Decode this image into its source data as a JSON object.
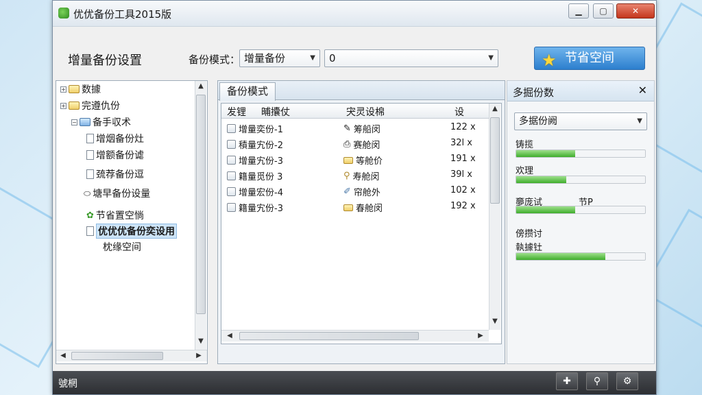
{
  "window": {
    "title": "优优备份工具2015版"
  },
  "toolbar": {
    "settings_title": "增量备份设置",
    "mode_label": "备份模式：",
    "mode_value": "增量备份",
    "path_value": "0",
    "save_space_label": "节省空间"
  },
  "tree": {
    "items": [
      {
        "label": "数據",
        "icon": "folder-icon"
      },
      {
        "label": "完遵仇份",
        "icon": "folder-icon"
      },
      {
        "label": "备手収术",
        "icon": "folder-icon"
      },
      {
        "label": "增烟备份灶",
        "icon": "document-icon"
      },
      {
        "label": "增额备份谑",
        "icon": "document-icon"
      },
      {
        "label": "巯荐备份逗",
        "icon": "document-icon"
      },
      {
        "label": "塘早备份设量",
        "icon": "drive-icon"
      },
      {
        "label": "节省置空惝",
        "icon": "app-icon"
      },
      {
        "label": "优优优备份奕设用",
        "icon": "document-icon"
      },
      {
        "label": "枕缘空间",
        "icon": ""
      }
    ]
  },
  "main": {
    "tab_label": "备份模式",
    "columns": [
      "发锂",
      "晡攮仗",
      "宊灵设棉",
      "设"
    ],
    "rows": [
      {
        "name": "增量奕份-1",
        "type": "筹船闵",
        "size": "122 x",
        "icon": "file-icon",
        "type_icon": "pencil-icon"
      },
      {
        "name": "積量宄份-2",
        "type": "赛舱闵",
        "size": "32l x",
        "icon": "file-icon",
        "type_icon": "printer-icon"
      },
      {
        "name": "增量宄份-3",
        "type": "等舱价",
        "size": "191 x",
        "icon": "file-icon",
        "type_icon": "folder-icon"
      },
      {
        "name": "籍量觅份 3",
        "type": "寿舱闵",
        "size": "39l x",
        "icon": "file-icon",
        "type_icon": "pin-icon"
      },
      {
        "name": "增量宏份-4",
        "type": "帘舱外",
        "size": "102 x",
        "icon": "file-icon",
        "type_icon": "pen-icon"
      },
      {
        "name": "籍量宄份-3",
        "type": "春舱闵",
        "size": "192 x",
        "icon": "file-icon",
        "type_icon": "folder-icon"
      }
    ]
  },
  "side": {
    "title": "多掘份数",
    "select_value": "多据份阙",
    "stats": [
      {
        "label": "铸揽",
        "progress": 0.46
      },
      {
        "label": "欢理",
        "progress": 0.39
      },
      {
        "label": "夣庞试",
        "extra": "节P",
        "progress": 0.46
      },
      {
        "label": "傍攒讨",
        "progress": null
      },
      {
        "label": "執據钍",
        "progress": 0.69
      }
    ]
  },
  "status": {
    "text": "號棢"
  }
}
